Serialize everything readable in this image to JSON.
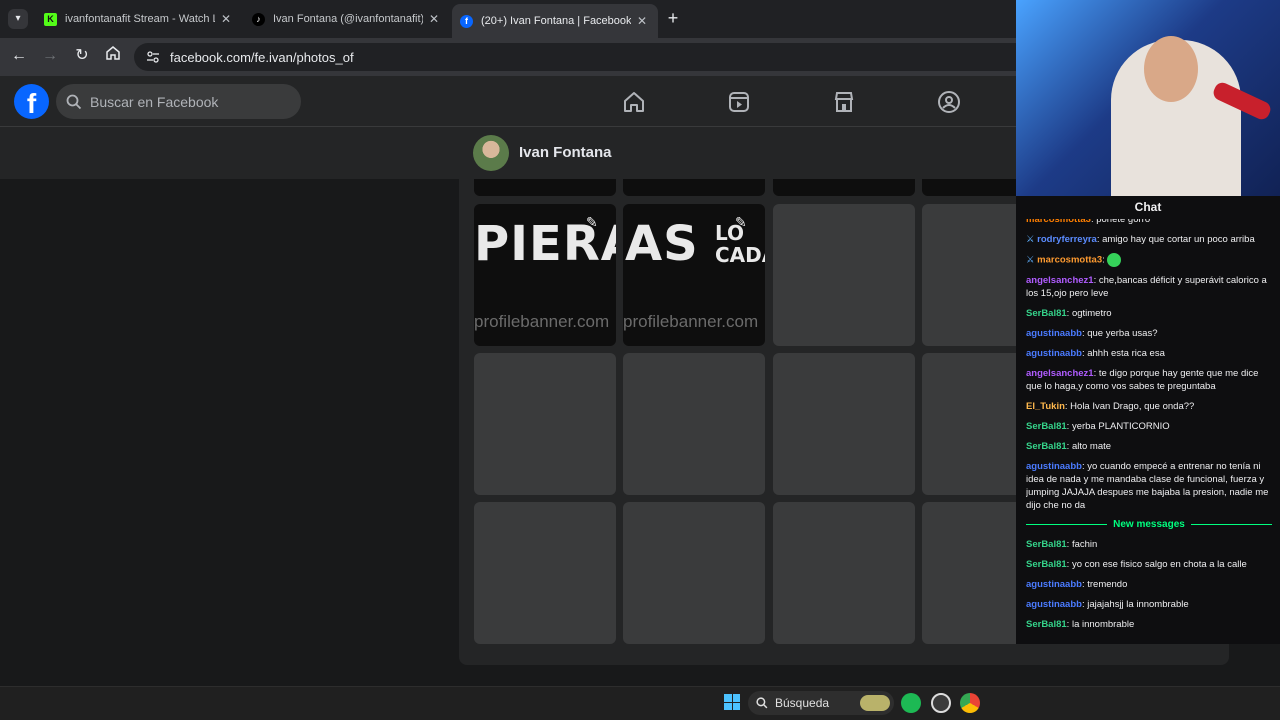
{
  "browser": {
    "tabs": [
      {
        "title": "ivanfontanafit Stream - Watch Live",
        "favicon": "kick-icon",
        "active": false
      },
      {
        "title": "Ivan Fontana (@ivanfontanafit) es",
        "favicon": "tiktok-icon",
        "active": false
      },
      {
        "title": "(20+) Ivan Fontana | Facebook",
        "favicon": "facebook-icon",
        "active": true
      }
    ],
    "new_tab": "+",
    "close": "✕",
    "url": "facebook.com/fe.ivan/photos_of"
  },
  "facebook": {
    "logo": "f",
    "search_placeholder": "Buscar en Facebook",
    "profile_name": "Ivan Fontana",
    "banner": {
      "text_left": "PIERAS",
      "text_right": "AS",
      "text_corner": "LO CADA",
      "watermark": "profilebanner.com"
    }
  },
  "chat": {
    "title": "Chat",
    "new_messages_label": "New messages",
    "messages": [
      {
        "user": "marcosmotta3",
        "text": "ponete gorro",
        "color": "#ff7f00",
        "badge": false
      },
      {
        "user": "rodryferreyra",
        "text": "amigo hay que cortar un poco arriba",
        "color": "#5b8cff",
        "badge": true
      },
      {
        "user": "marcosmotta3",
        "text": "",
        "color": "#ff9b30",
        "badge": true,
        "emote": true
      },
      {
        "user": "angelsanchez1",
        "text": "che,bancas déficit y superávit calorico a los 15,ojo pero leve",
        "color": "#b05cff",
        "badge": false
      },
      {
        "user": "SerBal81",
        "text": "ogtimetro",
        "color": "#35d28a",
        "badge": false
      },
      {
        "user": "agustinaabb",
        "text": "que yerba usas?",
        "color": "#4b7bff",
        "badge": false
      },
      {
        "user": "agustinaabb",
        "text": "ahhh esta rica esa",
        "color": "#4b7bff",
        "badge": false
      },
      {
        "user": "angelsanchez1",
        "text": "te digo porque hay gente que me dice que lo haga,y como vos sabes te preguntaba",
        "color": "#b05cff",
        "badge": false
      },
      {
        "user": "El_Tukin",
        "text": "Hola Ivan Drago, que onda??",
        "color": "#ffb84d",
        "badge": false
      },
      {
        "user": "SerBal81",
        "text": "yerba PLANTICORNIO",
        "color": "#35d28a",
        "badge": false
      },
      {
        "user": "SerBal81",
        "text": "alto mate",
        "color": "#35d28a",
        "badge": false
      },
      {
        "user": "agustinaabb",
        "text": "yo cuando empecé a entrenar no tenía ni idea de nada y me mandaba clase de funcional, fuerza y jumping JAJAJA despues me bajaba la presion, nadie me dijo che no da",
        "color": "#4b7bff",
        "badge": false
      }
    ],
    "new_messages": [
      {
        "user": "SerBal81",
        "text": "fachin",
        "color": "#35d28a"
      },
      {
        "user": "SerBal81",
        "text": "yo con ese fisico salgo en chota a la calle",
        "color": "#35d28a"
      },
      {
        "user": "agustinaabb",
        "text": "tremendo",
        "color": "#4b7bff"
      },
      {
        "user": "agustinaabb",
        "text": "jajajahsjj la innombrable",
        "color": "#4b7bff"
      },
      {
        "user": "SerBal81",
        "text": "la innombrable",
        "color": "#35d28a"
      }
    ]
  },
  "taskbar": {
    "search_label": "Búsqueda"
  },
  "colors": {
    "fb_blue": "#0866ff",
    "new_messages": "#00ff7f"
  }
}
